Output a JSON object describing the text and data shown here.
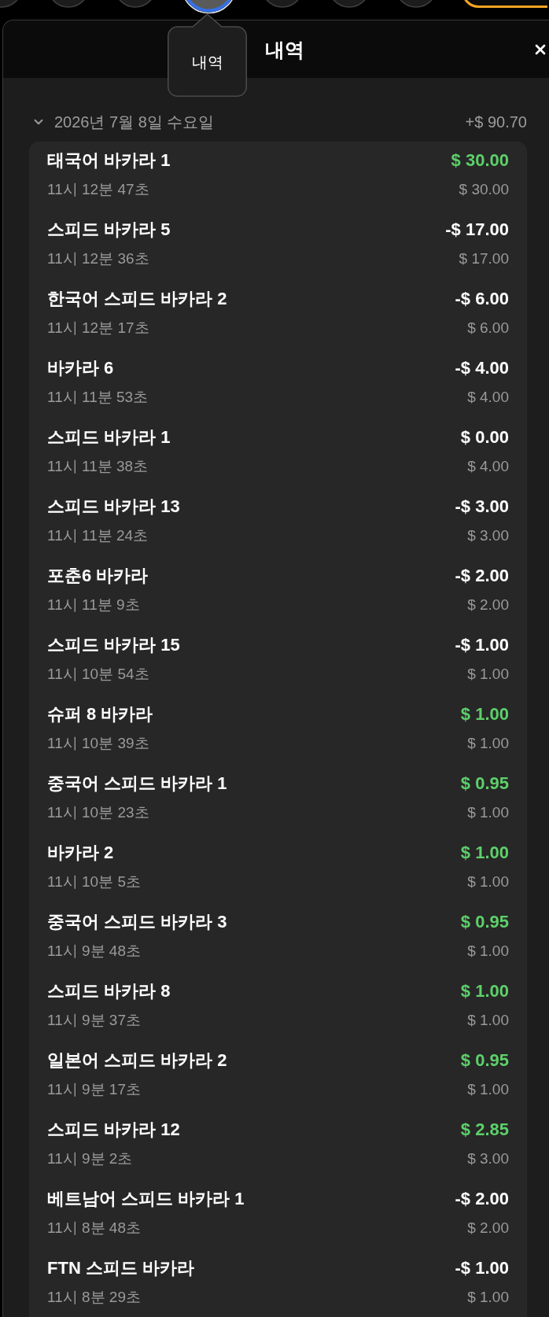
{
  "toolbar": {
    "buttons": [
      {
        "kind": "circle",
        "selected": false
      },
      {
        "kind": "circle",
        "selected": false
      },
      {
        "kind": "circle",
        "selected": false
      },
      {
        "kind": "circle",
        "selected": true
      },
      {
        "kind": "circle",
        "selected": false
      },
      {
        "kind": "circle",
        "selected": false
      },
      {
        "kind": "circle",
        "selected": false
      },
      {
        "kind": "pill",
        "selected": false
      }
    ]
  },
  "tooltip": {
    "text": "내역"
  },
  "panel": {
    "title": "내역",
    "date_group": {
      "date": "2026년 7월 8일 수요일",
      "expanded": true,
      "total": "+$ 90.70"
    },
    "entries": [
      {
        "game": "태국어 바카라 1",
        "time": "11시 12분 47초",
        "result": "$ 30.00",
        "won": true,
        "stake": "$ 30.00"
      },
      {
        "game": "스피드 바카라 5",
        "time": "11시 12분 36초",
        "result": "-$ 17.00",
        "won": false,
        "stake": "$ 17.00"
      },
      {
        "game": "한국어 스피드 바카라 2",
        "time": "11시 12분 17초",
        "result": "-$ 6.00",
        "won": false,
        "stake": "$ 6.00"
      },
      {
        "game": "바카라 6",
        "time": "11시 11분 53초",
        "result": "-$ 4.00",
        "won": false,
        "stake": "$ 4.00"
      },
      {
        "game": "스피드 바카라 1",
        "time": "11시 11분 38초",
        "result": "$ 0.00",
        "won": false,
        "stake": "$ 4.00"
      },
      {
        "game": "스피드 바카라 13",
        "time": "11시 11분 24초",
        "result": "-$ 3.00",
        "won": false,
        "stake": "$ 3.00"
      },
      {
        "game": "포춘6 바카라",
        "time": "11시 11분 9초",
        "result": "-$ 2.00",
        "won": false,
        "stake": "$ 2.00"
      },
      {
        "game": "스피드 바카라 15",
        "time": "11시 10분 54초",
        "result": "-$ 1.00",
        "won": false,
        "stake": "$ 1.00"
      },
      {
        "game": "슈퍼 8 바카라",
        "time": "11시 10분 39초",
        "result": "$ 1.00",
        "won": true,
        "stake": "$ 1.00"
      },
      {
        "game": "중국어 스피드 바카라 1",
        "time": "11시 10분 23초",
        "result": "$ 0.95",
        "won": true,
        "stake": "$ 1.00"
      },
      {
        "game": "바카라 2",
        "time": "11시 10분 5초",
        "result": "$ 1.00",
        "won": true,
        "stake": "$ 1.00"
      },
      {
        "game": "중국어 스피드 바카라 3",
        "time": "11시 9분 48초",
        "result": "$ 0.95",
        "won": true,
        "stake": "$ 1.00"
      },
      {
        "game": "스피드 바카라 8",
        "time": "11시 9분 37초",
        "result": "$ 1.00",
        "won": true,
        "stake": "$ 1.00"
      },
      {
        "game": "일본어 스피드 바카라 2",
        "time": "11시 9분 17초",
        "result": "$ 0.95",
        "won": true,
        "stake": "$ 1.00"
      },
      {
        "game": "스피드 바카라 12",
        "time": "11시 9분 2초",
        "result": "$ 2.85",
        "won": true,
        "stake": "$ 3.00"
      },
      {
        "game": "베트남어 스피드 바카라 1",
        "time": "11시 8분 48초",
        "result": "-$ 2.00",
        "won": false,
        "stake": "$ 2.00"
      },
      {
        "game": "FTN 스피드 바카라",
        "time": "11시 8분 29초",
        "result": "-$ 1.00",
        "won": false,
        "stake": "$ 1.00"
      }
    ]
  }
}
